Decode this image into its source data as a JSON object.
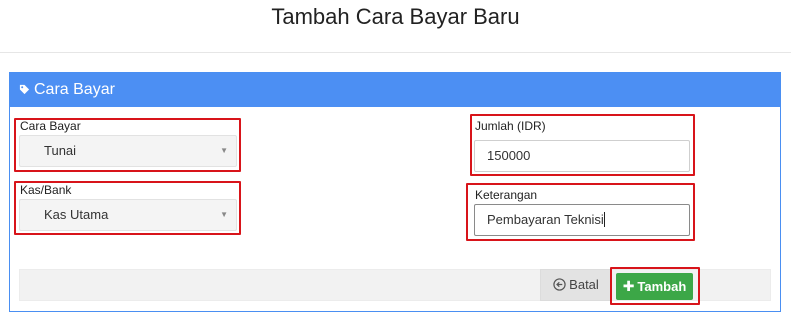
{
  "page": {
    "title": "Tambah Cara Bayar Baru"
  },
  "panel": {
    "title": "Cara Bayar",
    "icon": "tag-icon"
  },
  "form": {
    "cara_bayar": {
      "label": "Cara Bayar",
      "value": "Tunai"
    },
    "kas_bank": {
      "label": "Kas/Bank",
      "value": "Kas Utama"
    },
    "jumlah": {
      "label": "Jumlah (IDR)",
      "value": "150000"
    },
    "keterangan": {
      "label": "Keterangan",
      "value": "Pembayaran Teknisi"
    }
  },
  "actions": {
    "cancel_label": "Batal",
    "cancel_icon": "circle-arrow-left-icon",
    "add_label": "Tambah",
    "add_icon": "plus-icon"
  },
  "colors": {
    "header_bg": "#4c8ff3",
    "highlight": "#d8141a",
    "add_button": "#3ca747"
  }
}
